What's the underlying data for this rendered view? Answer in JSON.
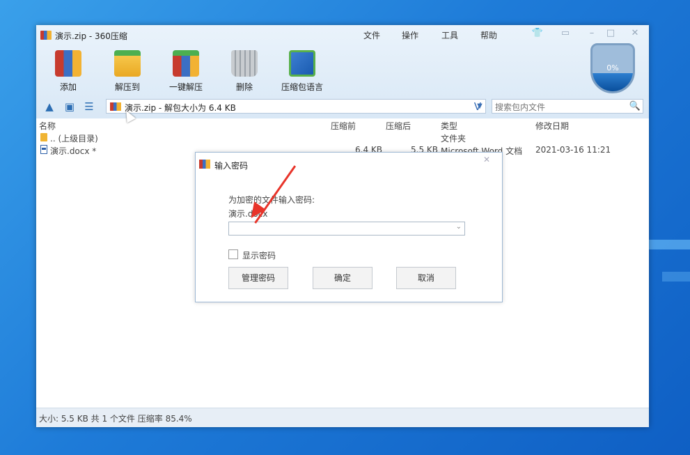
{
  "window": {
    "title": "演示.zip - 360压缩",
    "menu": [
      "文件",
      "操作",
      "工具",
      "帮助"
    ],
    "shield_percent": "0%"
  },
  "toolbar": [
    {
      "label": "添加",
      "icon": "add-archive-icon"
    },
    {
      "label": "解压到",
      "icon": "extract-to-icon"
    },
    {
      "label": "一键解压",
      "icon": "one-click-extract-icon"
    },
    {
      "label": "删除",
      "icon": "trash-icon"
    },
    {
      "label": "压缩包语言",
      "icon": "archive-language-icon"
    }
  ],
  "nav": {
    "address": "演示.zip - 解包大小为 6.4 KB",
    "search_placeholder": "搜索包内文件"
  },
  "columns": {
    "name": "名称",
    "packed": "压缩前",
    "unpacked": "压缩后",
    "type": "类型",
    "modified": "修改日期"
  },
  "rows": [
    {
      "name": ".. (上级目录)",
      "packed": "",
      "unpacked": "",
      "type": "文件夹",
      "modified": ""
    },
    {
      "name": "演示.docx *",
      "packed": "6.4 KB",
      "unpacked": "5.5 KB",
      "type": "Microsoft Word 文档",
      "modified": "2021-03-16 11:21"
    }
  ],
  "status": "大小: 5.5 KB 共 1 个文件 压缩率 85.4%",
  "dialog": {
    "title": "输入密码",
    "prompt": "为加密的文件输入密码:",
    "filename": "演示.docx",
    "password_value": "",
    "show_password_label": "显示密码",
    "show_password_checked": false,
    "buttons": {
      "manage": "管理密码",
      "ok": "确定",
      "cancel": "取消"
    }
  },
  "colors": {
    "accent": "#2b6db3",
    "annotation_arrow": "#e8342a",
    "desktop": "#1e7bd8"
  }
}
